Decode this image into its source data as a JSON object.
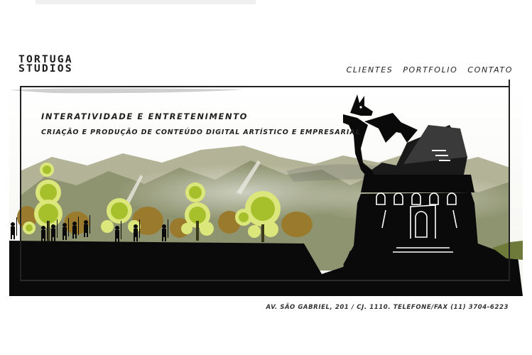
{
  "logo": {
    "line1": "TORTUGA",
    "line2": "STUDIOS"
  },
  "nav": {
    "items": [
      "CLIENTES",
      "PORTFOLIO",
      "CONTATO"
    ]
  },
  "banner": {
    "tagline": "INTERATIVIDADE E ENTRETENIMENTO",
    "subtagline": "CRIAÇÃO E PRODUÇÃO DE CONTEÚDO DIGITAL ARTÍSTICO E EMPRESARIAL"
  },
  "footer": {
    "address": "AV. SÃO GABRIEL, 201 / CJ. 1110. TELEFONE/FAX (11) 3704-6223"
  },
  "colors": {
    "mountain": "#8f9470",
    "mountain_far": "#b3b497",
    "tree_green": "#a6c02c",
    "tree_light": "#dbe77a",
    "tree_brown": "#9a7a2c",
    "silhouette": "#0a0a0a"
  }
}
